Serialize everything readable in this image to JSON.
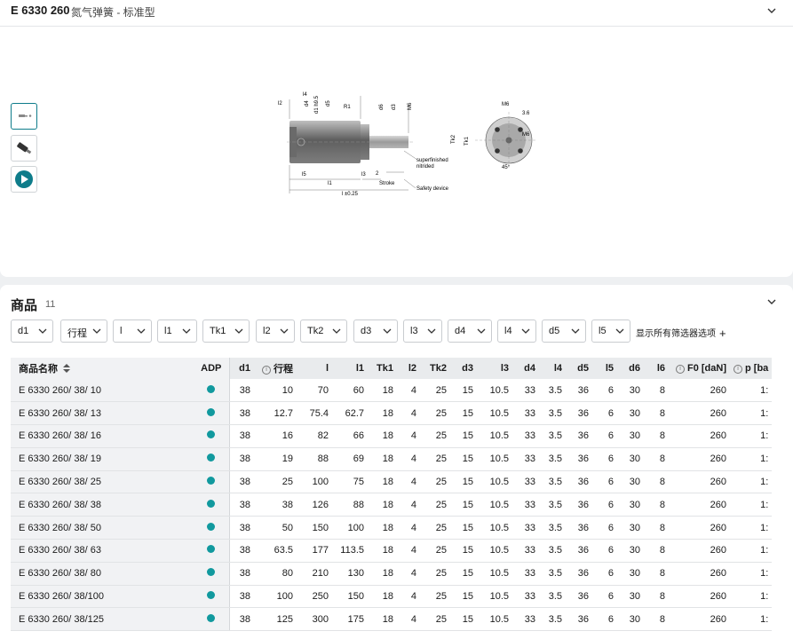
{
  "product": {
    "code": "E 6330 260",
    "description": "氮气弹簧 - 标准型"
  },
  "gallery": {
    "thumbs": [
      {
        "name": "drawing-thumbnail",
        "active": true
      },
      {
        "name": "product-photo-thumbnail",
        "active": false
      },
      {
        "name": "video-thumbnail",
        "active": false
      }
    ],
    "drawing_labels": {
      "l4": "l4",
      "l2": "l2",
      "d4": "d4",
      "d1": "d1 h9.5",
      "d5": "d5",
      "r1": "R1",
      "d6": "d6",
      "d3": "d3",
      "m6": "M6",
      "l5": "l5",
      "l3": "l3",
      "two": "2",
      "l1": "l1",
      "l": "l ±0.25",
      "stroke": "Stroke",
      "superfinished": "superfinished",
      "nitrided": "nitrided",
      "safety": "Safety device",
      "tk2": "Tk2",
      "tk1": "Tk1",
      "m6b": "M6",
      "dim36": "3.6",
      "m6c": "M6",
      "angle": "45°"
    }
  },
  "section": {
    "title": "商品",
    "count": "11"
  },
  "filters": [
    "d1",
    "行程",
    "l",
    "l1",
    "Tk1",
    "l2",
    "Tk2",
    "d3",
    "l3",
    "d4",
    "l4",
    "d5",
    "l5"
  ],
  "show_all_filters": "显示所有筛选器选项",
  "table": {
    "columns": [
      {
        "key": "name",
        "label": "商品名称"
      },
      {
        "key": "adp",
        "label": "ADP"
      },
      {
        "key": "d1",
        "label": "d1"
      },
      {
        "key": "stroke",
        "label": "行程",
        "info": true
      },
      {
        "key": "l",
        "label": "l"
      },
      {
        "key": "l1",
        "label": "l1"
      },
      {
        "key": "tk1",
        "label": "Tk1"
      },
      {
        "key": "l2",
        "label": "l2"
      },
      {
        "key": "tk2",
        "label": "Tk2"
      },
      {
        "key": "d3",
        "label": "d3"
      },
      {
        "key": "l3",
        "label": "l3"
      },
      {
        "key": "d4",
        "label": "d4"
      },
      {
        "key": "l4",
        "label": "l4"
      },
      {
        "key": "d5",
        "label": "d5"
      },
      {
        "key": "l5",
        "label": "l5"
      },
      {
        "key": "d6",
        "label": "d6"
      },
      {
        "key": "l6",
        "label": "l6"
      },
      {
        "key": "f0",
        "label": "F0 [daN]",
        "info": true
      },
      {
        "key": "p",
        "label": "p [ba",
        "info": true
      }
    ],
    "rows": [
      {
        "name": "E 6330 260/ 38/ 10",
        "d1": "38",
        "stroke": "10",
        "l": "70",
        "l1": "60",
        "tk1": "18",
        "l2": "4",
        "tk2": "25",
        "d3": "15",
        "l3": "10.5",
        "d4": "33",
        "l4": "3.5",
        "d5": "36",
        "l5": "6",
        "d6": "30",
        "l6": "8",
        "f0": "260",
        "p": "1:"
      },
      {
        "name": "E 6330 260/ 38/ 13",
        "d1": "38",
        "stroke": "12.7",
        "l": "75.4",
        "l1": "62.7",
        "tk1": "18",
        "l2": "4",
        "tk2": "25",
        "d3": "15",
        "l3": "10.5",
        "d4": "33",
        "l4": "3.5",
        "d5": "36",
        "l5": "6",
        "d6": "30",
        "l6": "8",
        "f0": "260",
        "p": "1:"
      },
      {
        "name": "E 6330 260/ 38/ 16",
        "d1": "38",
        "stroke": "16",
        "l": "82",
        "l1": "66",
        "tk1": "18",
        "l2": "4",
        "tk2": "25",
        "d3": "15",
        "l3": "10.5",
        "d4": "33",
        "l4": "3.5",
        "d5": "36",
        "l5": "6",
        "d6": "30",
        "l6": "8",
        "f0": "260",
        "p": "1:"
      },
      {
        "name": "E 6330 260/ 38/ 19",
        "d1": "38",
        "stroke": "19",
        "l": "88",
        "l1": "69",
        "tk1": "18",
        "l2": "4",
        "tk2": "25",
        "d3": "15",
        "l3": "10.5",
        "d4": "33",
        "l4": "3.5",
        "d5": "36",
        "l5": "6",
        "d6": "30",
        "l6": "8",
        "f0": "260",
        "p": "1:"
      },
      {
        "name": "E 6330 260/ 38/ 25",
        "d1": "38",
        "stroke": "25",
        "l": "100",
        "l1": "75",
        "tk1": "18",
        "l2": "4",
        "tk2": "25",
        "d3": "15",
        "l3": "10.5",
        "d4": "33",
        "l4": "3.5",
        "d5": "36",
        "l5": "6",
        "d6": "30",
        "l6": "8",
        "f0": "260",
        "p": "1:"
      },
      {
        "name": "E 6330 260/ 38/ 38",
        "d1": "38",
        "stroke": "38",
        "l": "126",
        "l1": "88",
        "tk1": "18",
        "l2": "4",
        "tk2": "25",
        "d3": "15",
        "l3": "10.5",
        "d4": "33",
        "l4": "3.5",
        "d5": "36",
        "l5": "6",
        "d6": "30",
        "l6": "8",
        "f0": "260",
        "p": "1:"
      },
      {
        "name": "E 6330 260/ 38/ 50",
        "d1": "38",
        "stroke": "50",
        "l": "150",
        "l1": "100",
        "tk1": "18",
        "l2": "4",
        "tk2": "25",
        "d3": "15",
        "l3": "10.5",
        "d4": "33",
        "l4": "3.5",
        "d5": "36",
        "l5": "6",
        "d6": "30",
        "l6": "8",
        "f0": "260",
        "p": "1:"
      },
      {
        "name": "E 6330 260/ 38/ 63",
        "d1": "38",
        "stroke": "63.5",
        "l": "177",
        "l1": "113.5",
        "tk1": "18",
        "l2": "4",
        "tk2": "25",
        "d3": "15",
        "l3": "10.5",
        "d4": "33",
        "l4": "3.5",
        "d5": "36",
        "l5": "6",
        "d6": "30",
        "l6": "8",
        "f0": "260",
        "p": "1:"
      },
      {
        "name": "E 6330 260/ 38/ 80",
        "d1": "38",
        "stroke": "80",
        "l": "210",
        "l1": "130",
        "tk1": "18",
        "l2": "4",
        "tk2": "25",
        "d3": "15",
        "l3": "10.5",
        "d4": "33",
        "l4": "3.5",
        "d5": "36",
        "l5": "6",
        "d6": "30",
        "l6": "8",
        "f0": "260",
        "p": "1:"
      },
      {
        "name": "E 6330 260/ 38/100",
        "d1": "38",
        "stroke": "100",
        "l": "250",
        "l1": "150",
        "tk1": "18",
        "l2": "4",
        "tk2": "25",
        "d3": "15",
        "l3": "10.5",
        "d4": "33",
        "l4": "3.5",
        "d5": "36",
        "l5": "6",
        "d6": "30",
        "l6": "8",
        "f0": "260",
        "p": "1:"
      },
      {
        "name": "E 6330 260/ 38/125",
        "d1": "38",
        "stroke": "125",
        "l": "300",
        "l1": "175",
        "tk1": "18",
        "l2": "4",
        "tk2": "25",
        "d3": "15",
        "l3": "10.5",
        "d4": "33",
        "l4": "3.5",
        "d5": "36",
        "l5": "6",
        "d6": "30",
        "l6": "8",
        "f0": "260",
        "p": "1:"
      }
    ]
  },
  "colors": {
    "adp_dot": "#11999e",
    "accent": "#0e7c8a"
  },
  "icons": {
    "sort": "sort-icon",
    "info": "info-icon",
    "chevron": "chevron-down-icon",
    "plus": "plus-icon",
    "play": "play-icon"
  }
}
